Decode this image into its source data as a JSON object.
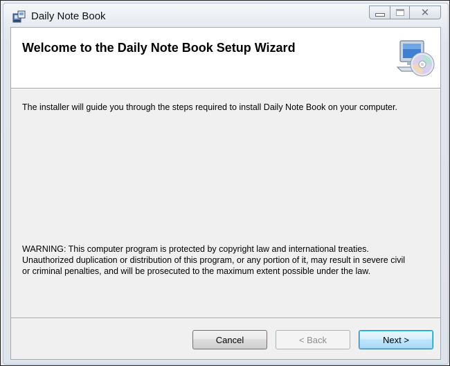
{
  "window": {
    "title": "Daily Note Book",
    "app_icon": "installer-package-icon",
    "controls": {
      "minimize_icon": "minimize-icon",
      "maximize_icon": "maximize-icon",
      "close_glyph": "✕"
    }
  },
  "banner": {
    "title": "Welcome to the Daily Note Book Setup Wizard",
    "icon": "computer-cd-icon"
  },
  "body": {
    "intro": "The installer will guide you through the steps required to install Daily Note Book on your computer.",
    "warning_lines": [
      "WARNING: This computer program is protected by copyright law and international treaties.",
      "Unauthorized duplication or distribution of this program, or any portion of it, may result in severe civil",
      "or criminal penalties, and will be prosecuted to the maximum extent possible under the law."
    ]
  },
  "buttons": {
    "cancel": "Cancel",
    "back": "< Back",
    "next": "Next >"
  },
  "colors": {
    "banner_background": "#ffffff",
    "client_background": "#f0f0f0",
    "default_button_border": "#3c7fb1",
    "disabled_text": "#8d8d8d"
  }
}
